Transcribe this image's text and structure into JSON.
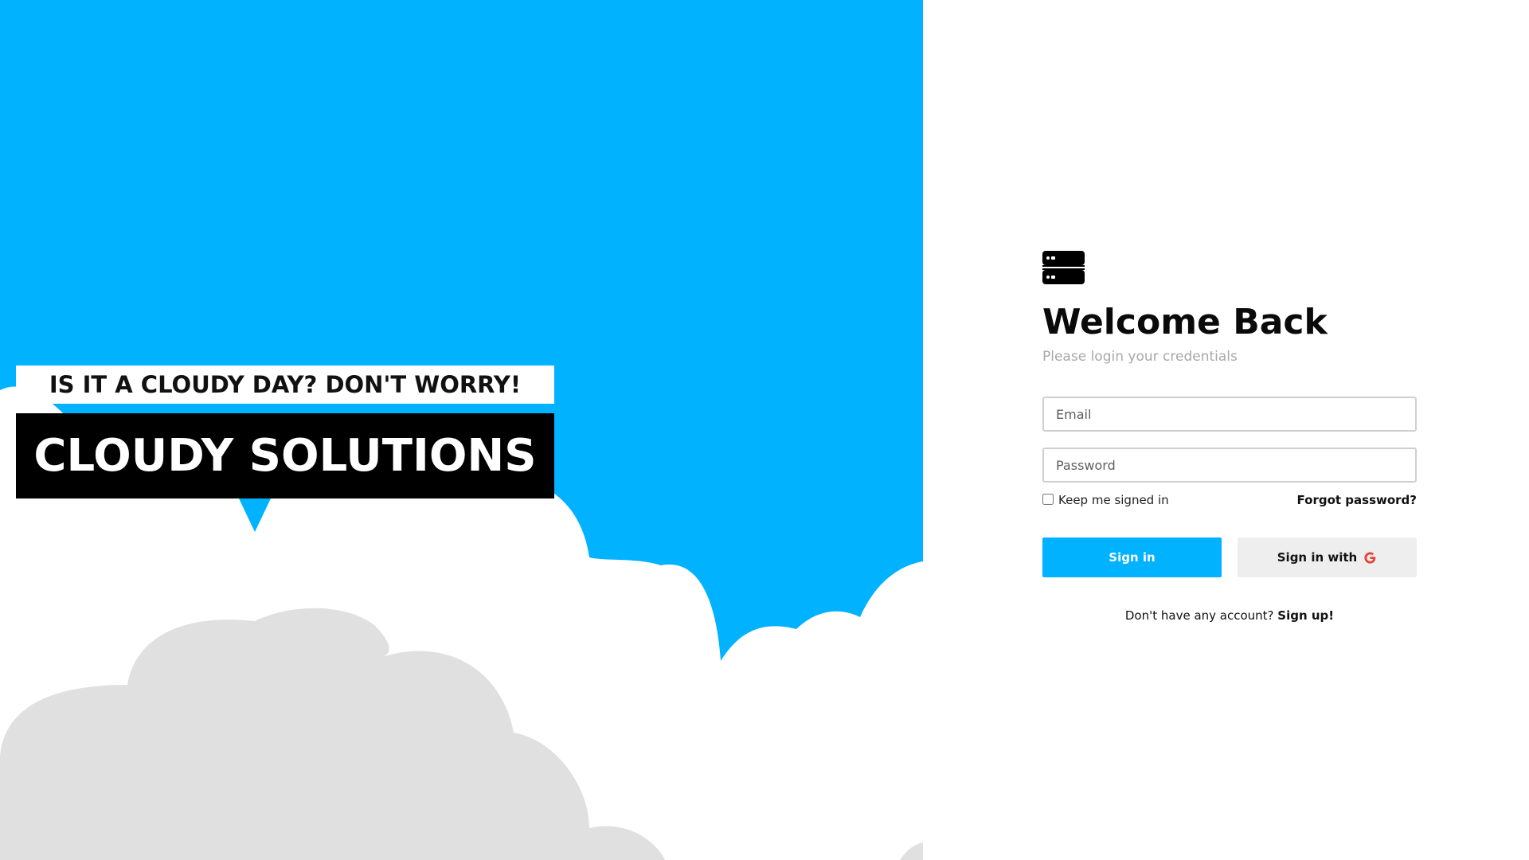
{
  "hero": {
    "tagline": "IS IT A CLOUDY DAY? DON'T WORRY!",
    "brand": "CLOUDY SOLUTIONS",
    "icons": [
      "cloud-shape"
    ]
  },
  "login": {
    "logo_icon": "server-icon",
    "title": "Welcome Back",
    "subtitle": "Please login your credentials",
    "email_placeholder": "Email",
    "password_placeholder": "Password",
    "remember_label": "Keep me signed in",
    "forgot_label": "Forgot password?",
    "signin_label": "Sign in",
    "google_label": "Sign in with",
    "google_icon": "google-g-icon",
    "signup_prompt": "Don't have any account?",
    "signup_link": "Sign up!"
  },
  "colors": {
    "accent": "#00b2ff",
    "cloud_white": "#ffffff",
    "cloud_gray": "#e0e0e0",
    "google_red": "#ea4335"
  }
}
